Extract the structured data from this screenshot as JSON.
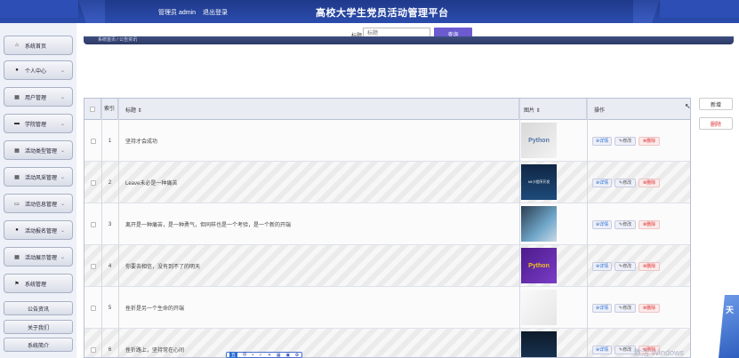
{
  "header": {
    "admin_label": "管理员 admin",
    "logout_label": "退出登录",
    "site_title": "高校大学生党员活动管理平台"
  },
  "sidebar": {
    "items": [
      {
        "label": "系统首页",
        "icon": "home-icon",
        "glyph": "⌂"
      },
      {
        "label": "个人中心",
        "icon": "user-icon",
        "glyph": "●"
      },
      {
        "label": "用户管理",
        "icon": "grid-icon",
        "glyph": "▦"
      },
      {
        "label": "学院管理",
        "icon": "monitor-icon",
        "glyph": "▬"
      },
      {
        "label": "活动类型管理",
        "icon": "grid-icon",
        "glyph": "▦"
      },
      {
        "label": "活动风采管理",
        "icon": "grid-icon",
        "glyph": "▦"
      },
      {
        "label": "活动信息管理",
        "icon": "card-icon",
        "glyph": "▭"
      },
      {
        "label": "活动报名管理",
        "icon": "user-icon",
        "glyph": "●"
      },
      {
        "label": "活动展示管理",
        "icon": "grid-icon",
        "glyph": "▦"
      },
      {
        "label": "系统管理",
        "icon": "flag-icon",
        "glyph": "⚑"
      }
    ],
    "sub_items": [
      "公告资讯",
      "关于我们",
      "系统简介"
    ]
  },
  "search": {
    "label": "标题",
    "placeholder": "标题",
    "button": "查询"
  },
  "breadcrumb": "系统首页 / 公告资讯",
  "actions": {
    "add": "新增",
    "delete": "删除"
  },
  "table": {
    "headers": [
      "索引",
      "标题 ⇕",
      "图片 ⇕",
      "操作"
    ],
    "op_labels": {
      "view": "⊕详情",
      "edit": "✎修改",
      "remove": "⊗删除"
    },
    "rows": [
      {
        "index": "1",
        "title": "坚持才会成功",
        "thumb_text": "Python",
        "thumb": "python-book"
      },
      {
        "index": "2",
        "title": "Leave未必是一种痛苦",
        "thumb_text": "h5小程序开发",
        "thumb": "dev-dark"
      },
      {
        "index": "3",
        "title": "离开是一种痛苦，是一种勇气，但同样也是一个考验，是一个新的开端",
        "thumb_text": "",
        "thumb": "laptop"
      },
      {
        "index": "4",
        "title": "你要去相信，没有到不了的明天",
        "thumb_text": "Python",
        "thumb": "python-purple"
      },
      {
        "index": "5",
        "title": "挫折是另一个生命的开端",
        "thumb_text": "",
        "thumb": "girl"
      },
      {
        "index": "6",
        "title": "挫折路上，坚持常在心间",
        "thumb_text": "",
        "thumb": "code"
      }
    ]
  },
  "ime_bar": [
    "中",
    "•",
    "✓",
    "✕",
    "▦",
    "▣",
    "✿"
  ],
  "ime_main": "五",
  "watermark": "激活 Windows",
  "deco_char": "天"
}
